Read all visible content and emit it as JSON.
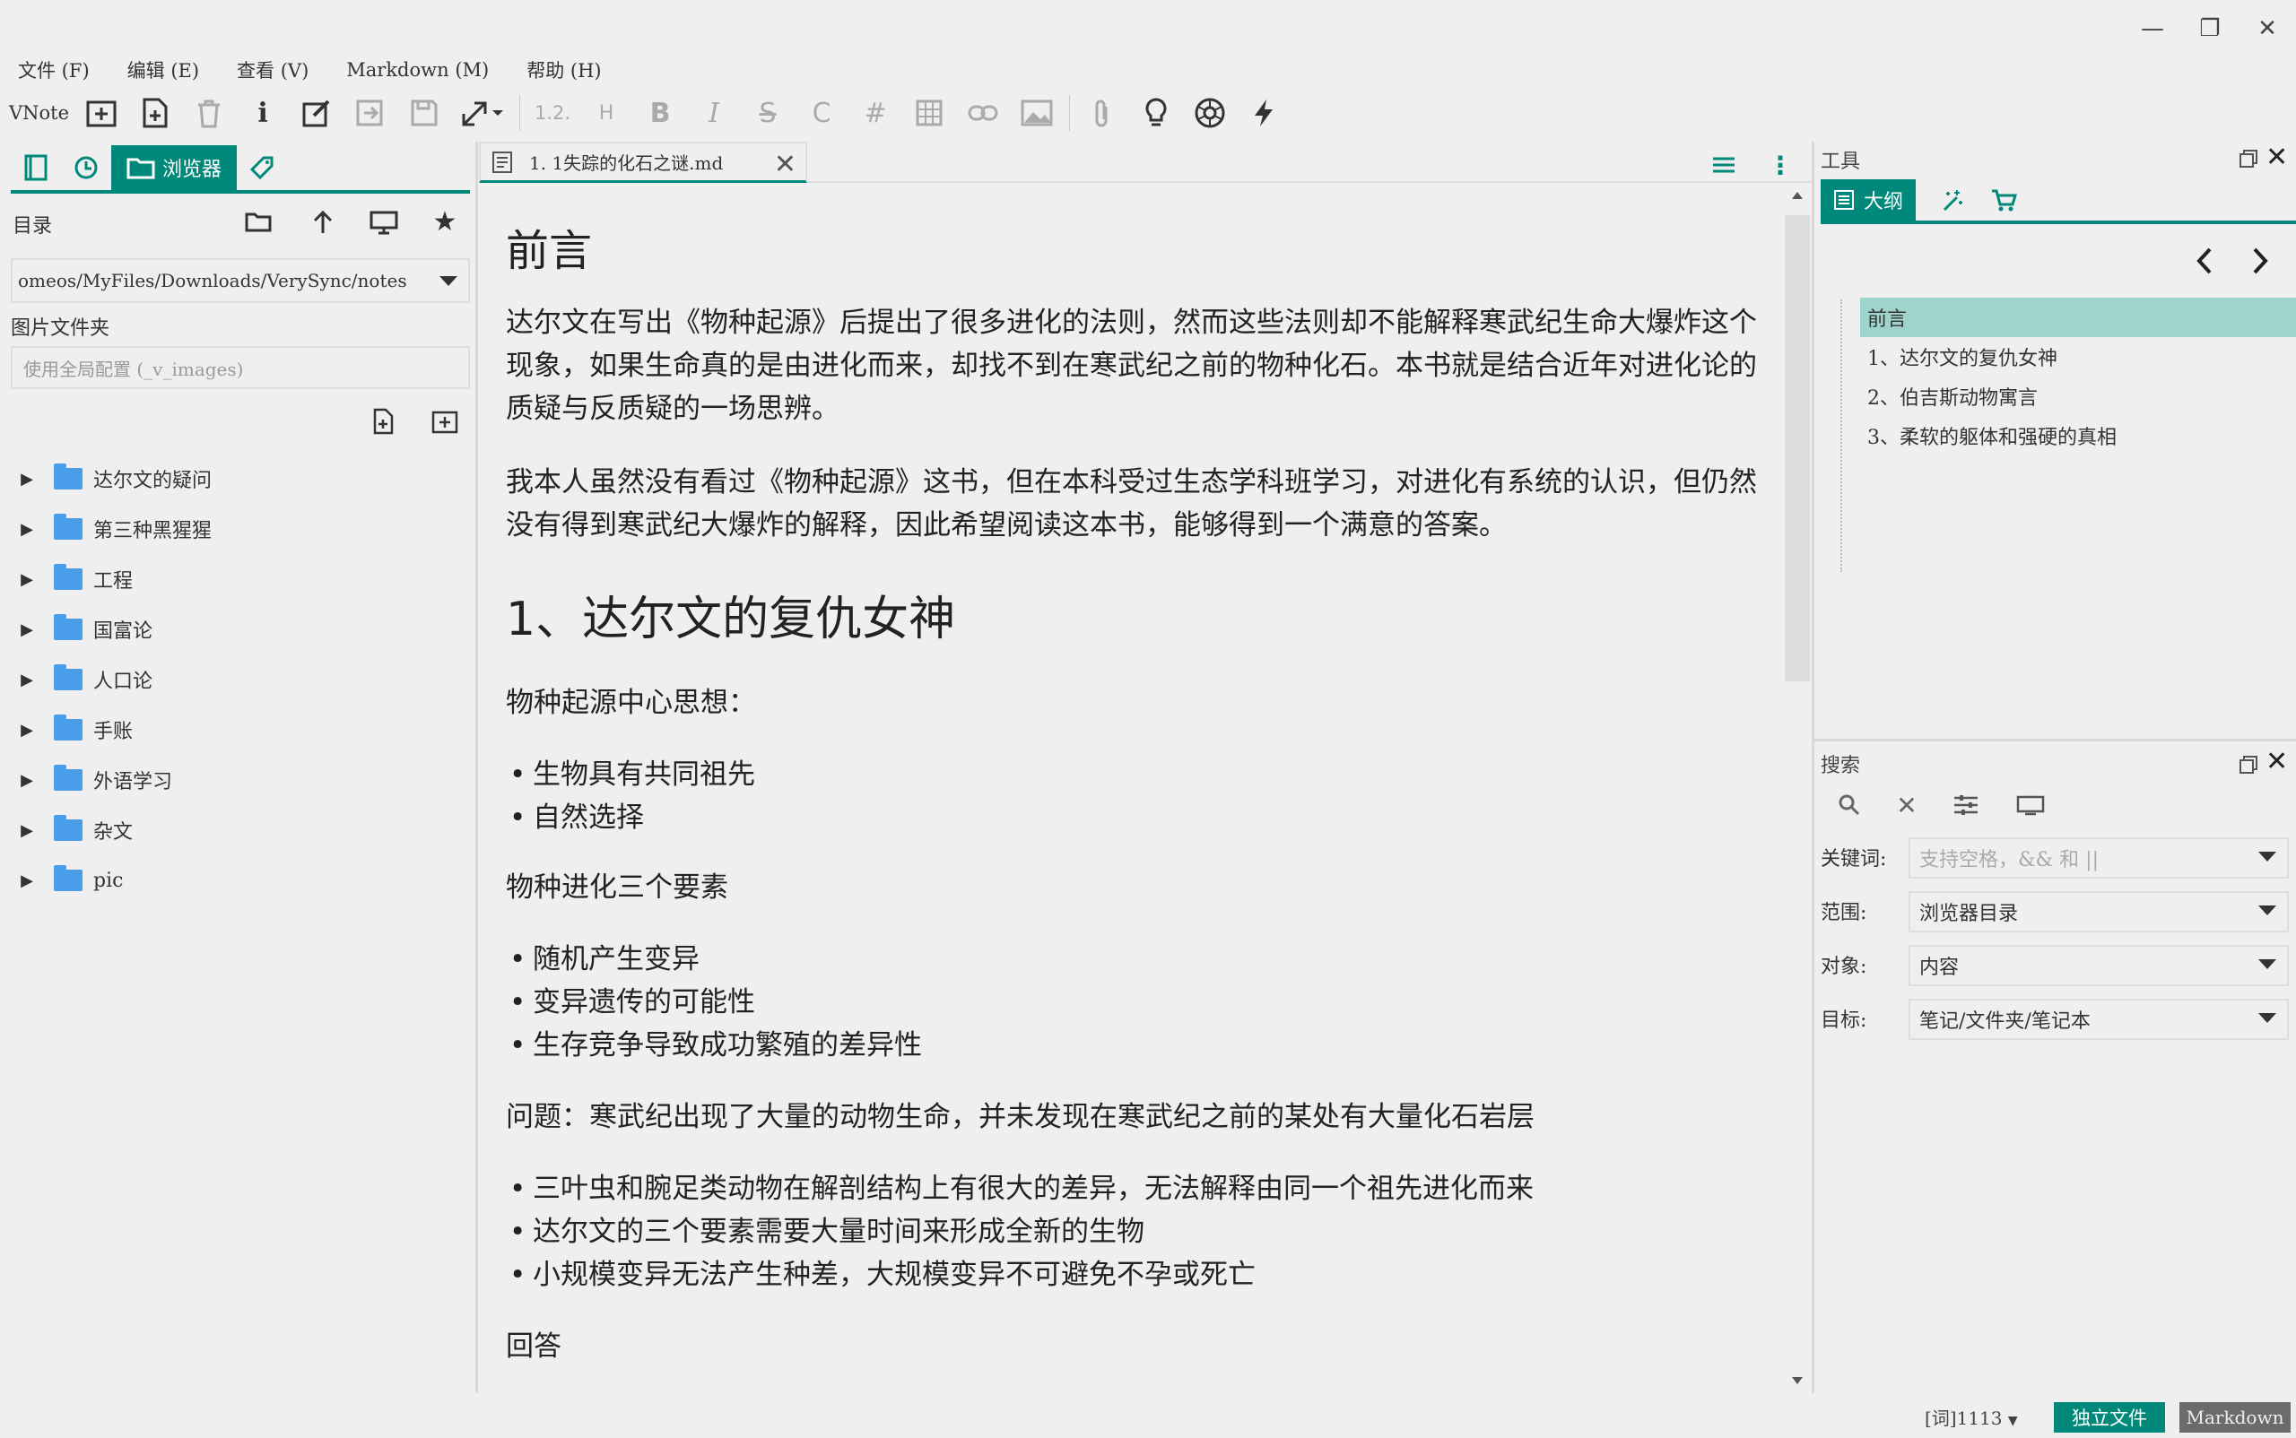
{
  "window": {
    "minimize": "—",
    "maximize": "❐",
    "close": "✕"
  },
  "menu": [
    "文件 (F)",
    "编辑 (E)",
    "查看 (V)",
    "Markdown (M)",
    "帮助 (H)"
  ],
  "toolbar": {
    "label": "VNote",
    "heading_num": "1.2.",
    "heading": "H",
    "bold": "B",
    "italic": "I",
    "strike": "S",
    "code": "C",
    "hash": "#"
  },
  "left": {
    "tab_browser": "浏览器",
    "dir_label": "目录",
    "notebook_path": "omeos/MyFiles/Downloads/VerySync/notes",
    "image_folder_label": "图片文件夹",
    "image_folder_placeholder": "使用全局配置 (_v_images)",
    "folders": [
      "达尔文的疑问",
      "第三种黑猩猩",
      "工程",
      "国富论",
      "人口论",
      "手账",
      "外语学习",
      "杂文",
      "pic"
    ]
  },
  "editor": {
    "tab_title": "1. 1失踪的化石之谜.md",
    "h_preface": "前言",
    "p1": "达尔文在写出《物种起源》后提出了很多进化的法则，然而这些法则却不能解释寒武纪生命大爆炸这个现象，如果生命真的是由进化而来，却找不到在寒武纪之前的物种化石。本书就是结合近年对进化论的质疑与反质疑的一场思辨。",
    "p2": "我本人虽然没有看过《物种起源》这书，但在本科受过生态学科班学习，对进化有系统的认识，但仍然没有得到寒武纪大爆炸的解释，因此希望阅读这本书，能够得到一个满意的答案。",
    "h_section1": "1、达尔文的复仇女神",
    "p3": "物种起源中心思想：",
    "list1": [
      "生物具有共同祖先",
      "自然选择"
    ],
    "p4": "物种进化三个要素",
    "list2": [
      "随机产生变异",
      "变异遗传的可能性",
      "生存竞争导致成功繁殖的差异性"
    ],
    "p5": "问题：寒武纪出现了大量的动物生命，并未发现在寒武纪之前的某处有大量化石岩层",
    "list3": [
      "三叶虫和腕足类动物在解剖结构上有很大的差异，无法解释由同一个祖先进化而来",
      "达尔文的三个要素需要大量时间来形成全新的生物",
      "小规模变异无法产生种差，大规模变异不可避免不孕或死亡"
    ],
    "p6": "回答"
  },
  "tools": {
    "title": "工具",
    "outline_tab": "大纲",
    "outline": [
      "前言",
      "1、达尔文的复仇女神",
      "2、伯吉斯动物寓言",
      "3、柔软的躯体和强硬的真相"
    ]
  },
  "search": {
    "title": "搜索",
    "keyword_label": "关键词:",
    "keyword_placeholder": "支持空格，&& 和 ||",
    "scope_label": "范围:",
    "scope_value": "浏览器目录",
    "object_label": "对象:",
    "object_value": "内容",
    "target_label": "目标:",
    "target_value": "笔记/文件夹/笔记本"
  },
  "status": {
    "words": "[词]1113",
    "mode1": "独立文件",
    "mode2": "Markdown"
  },
  "colors": {
    "accent": "#00897b",
    "outline_highlight": "#9fd4cd",
    "folder": "#4a9de8"
  }
}
